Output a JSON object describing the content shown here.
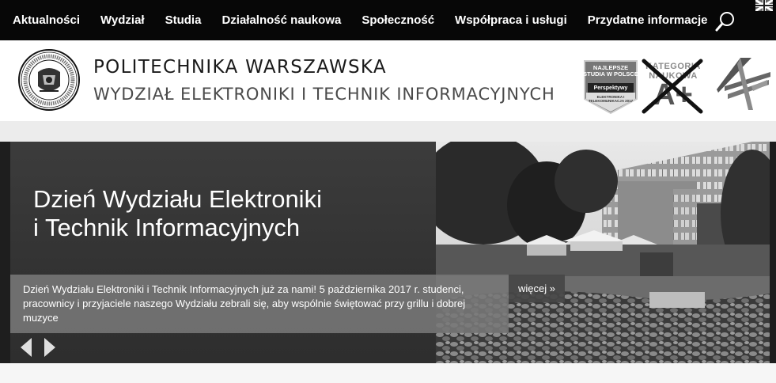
{
  "nav": {
    "items": [
      {
        "label": "Aktualności"
      },
      {
        "label": "Wydział"
      },
      {
        "label": "Studia"
      },
      {
        "label": "Działalność naukowa"
      },
      {
        "label": "Społeczność"
      },
      {
        "label": "Współpraca i usługi"
      },
      {
        "label": "Przydatne informacje"
      }
    ],
    "search_icon": "search-icon",
    "language_icon": "uk-flag-icon"
  },
  "header": {
    "university": "POLITECHNIKA WARSZAWSKA",
    "faculty": "WYDZIAŁ ELEKTRONIKI I TECHNIK INFORMACYJNYCH",
    "badge_perspektywy": {
      "line1": "NAJLEPSZE STUDIA W POLSCE",
      "line2": "Perspektywy",
      "line3": "ELEKTRONIKA I TELEKOMUNIKACJA 2017"
    },
    "badge_kategoria": {
      "label": "KATEGORIA NAUKOWA",
      "grade": "A+"
    }
  },
  "hero": {
    "title_line1": "Dzień Wydziału Elektroniki",
    "title_line2": "i Technik Informacyjnych",
    "caption": "Dzień Wydziału Elektroniki i Technik Informacyjnych już za nami! 5 października 2017 r. studenci, pracownicy i przyjaciele naszego Wydziału zebrali się, aby wspólnie świętować przy grillu i dobrej muzyce",
    "more_label": "więcej »"
  },
  "colors": {
    "nav_background": "#070707",
    "nav_text": "#ffffff",
    "hero_panel": "#3a3a3a",
    "caption_background": "#787878"
  }
}
